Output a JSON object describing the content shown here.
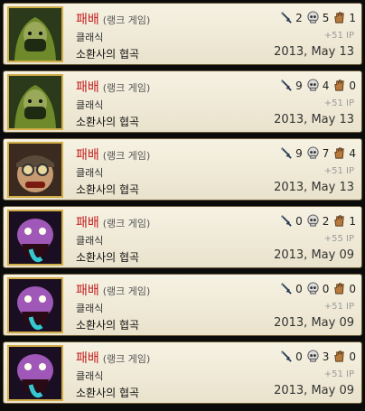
{
  "matches": [
    {
      "result": "패배",
      "queue": "(랭크 게임)",
      "mode": "클래식",
      "map": "소환사의 협곡",
      "date": "2013, May 13",
      "ip": "+51 IP",
      "kills": "2",
      "deaths": "5",
      "assists": "1",
      "champion_icon": "ninja-champion-portrait-icon"
    },
    {
      "result": "패배",
      "queue": "(랭크 게임)",
      "mode": "클래식",
      "map": "소환사의 협곡",
      "date": "2013, May 13",
      "ip": "+51 IP",
      "kills": "9",
      "deaths": "4",
      "assists": "0",
      "champion_icon": "ninja-champion-portrait-icon"
    },
    {
      "result": "패배",
      "queue": "(랭크 게임)",
      "mode": "클래식",
      "map": "소환사의 협곡",
      "date": "2013, May 13",
      "ip": "+51 IP",
      "kills": "9",
      "deaths": "7",
      "assists": "4",
      "champion_icon": "goggles-champion-portrait-icon"
    },
    {
      "result": "패배",
      "queue": "(랭크 게임)",
      "mode": "클래식",
      "map": "소환사의 협곡",
      "date": "2013, May 09",
      "ip": "+55 IP",
      "kills": "0",
      "deaths": "2",
      "assists": "1",
      "champion_icon": "monster-champion-portrait-icon"
    },
    {
      "result": "패배",
      "queue": "(랭크 게임)",
      "mode": "클래식",
      "map": "소환사의 협곡",
      "date": "2013, May 09",
      "ip": "+51 IP",
      "kills": "0",
      "deaths": "0",
      "assists": "0",
      "champion_icon": "monster-champion-portrait-icon"
    },
    {
      "result": "패배",
      "queue": "(랭크 게임)",
      "mode": "클래식",
      "map": "소환사의 협곡",
      "date": "2013, May 09",
      "ip": "+51 IP",
      "kills": "0",
      "deaths": "3",
      "assists": "0",
      "champion_icon": "monster-champion-portrait-icon"
    }
  ],
  "colors": {
    "defeat": "#c21d1d",
    "gold_border": "#d1ad48",
    "card_bg": "#f3efdf"
  }
}
